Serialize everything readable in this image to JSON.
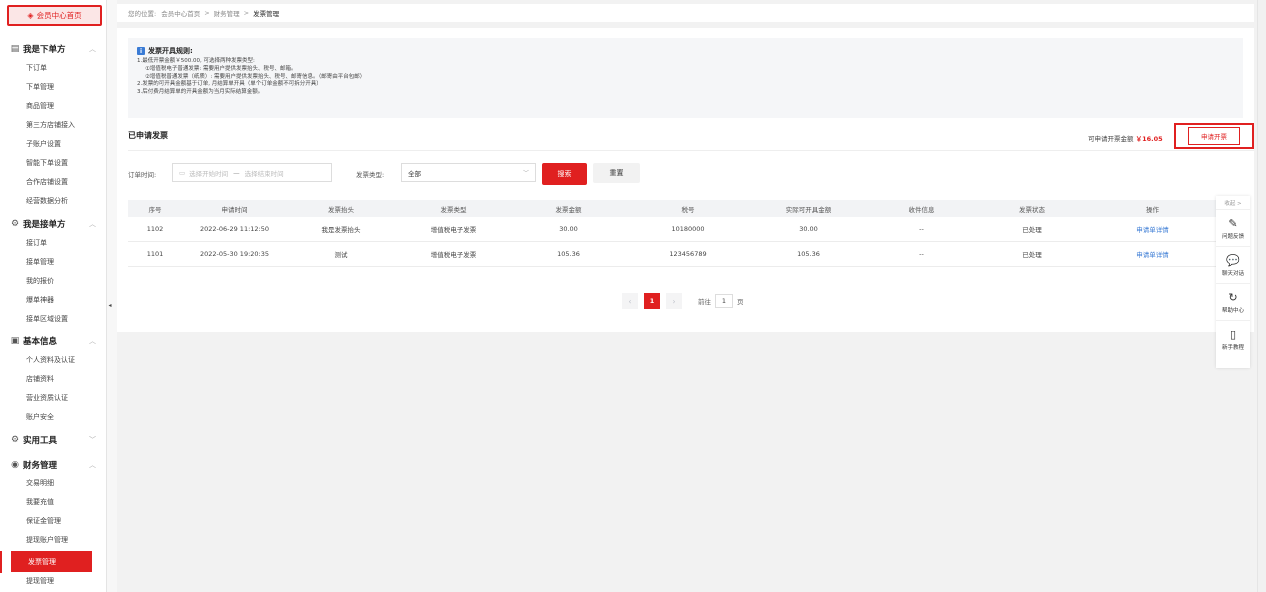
{
  "sidebar": {
    "home": "会员中心首页",
    "groups": [
      {
        "title": "我是下单方",
        "items": [
          "下订单",
          "下单管理",
          "商品管理",
          "第三方店铺接入",
          "子账户设置",
          "智能下单设置",
          "合作店铺设置",
          "经营数据分析"
        ]
      },
      {
        "title": "我是接单方",
        "items": [
          "接订单",
          "接单管理",
          "我的报价",
          "爆单神器",
          "接单区域设置"
        ]
      },
      {
        "title": "基本信息",
        "items": [
          "个人资料及认证",
          "店铺资料",
          "营业资质认证",
          "账户安全"
        ]
      },
      {
        "title": "实用工具",
        "items": []
      },
      {
        "title": "财务管理",
        "items": [
          "交易明细",
          "我要充值",
          "保证金管理",
          "提现账户管理",
          "发票管理",
          "提现管理"
        ]
      }
    ]
  },
  "breadcrumb": {
    "prefix": "您的位置:",
    "home": "会员中心首页",
    "mid": "财务管理",
    "current": "发票管理"
  },
  "rules": {
    "title": "发票开具规则:",
    "lines": [
      "1.最低开票金额￥500.00, 可选择两种发票类型:",
      "①增值税电子普通发票: 需要用户提供发票抬头、税号、邮箱。",
      "②增值税普通发票（纸质）: 需要用户提供发票抬头、税号、邮寄信息。（邮寄由平台包邮）",
      "2.发票的可开具金额基于订单, 月结算单开具（单个订单金额不可拆分开具）",
      "3.后付费月结算单的开具金额为当月实际结算金额。"
    ]
  },
  "section": {
    "title": "已申请发票",
    "avail_label": "可申请开票金额",
    "avail_amount": "￥16.05",
    "apply_button": "申请开票"
  },
  "filters": {
    "time_label": "订单时间:",
    "start_placeholder": "选择开始时间",
    "dash": "—",
    "end_placeholder": "选择结束时间",
    "type_label": "发票类型:",
    "type_value": "全部",
    "search": "搜索",
    "reset": "重置"
  },
  "table": {
    "headers": [
      "序号",
      "申请时间",
      "发票抬头",
      "发票类型",
      "发票金额",
      "税号",
      "实际可开具金额",
      "收件信息",
      "发票状态",
      "操作"
    ],
    "rows": [
      [
        "1102",
        "2022-06-29 11:12:50",
        "我是发票抬头",
        "增值税电子发票",
        "30.00",
        "10180000",
        "30.00",
        "--",
        "已处理",
        "申请单详情"
      ],
      [
        "1101",
        "2022-05-30 19:20:35",
        "测试",
        "增值税电子发票",
        "105.36",
        "123456789",
        "105.36",
        "--",
        "已处理",
        "申请单详情"
      ]
    ]
  },
  "pager": {
    "prev": "‹",
    "current": "1",
    "next": "›",
    "goto": "前往",
    "page_value": "1",
    "page_unit": "页"
  },
  "float_panel": {
    "fold": "收起 >",
    "items": [
      {
        "icon": "edit-icon",
        "label": "问题反馈"
      },
      {
        "icon": "chat-icon",
        "label": "聊天对话"
      },
      {
        "icon": "help-icon",
        "label": "帮助中心"
      },
      {
        "icon": "guide-icon",
        "label": "新手教程"
      }
    ]
  },
  "colors": {
    "accent": "#e02020",
    "link": "#3a7bd5"
  }
}
